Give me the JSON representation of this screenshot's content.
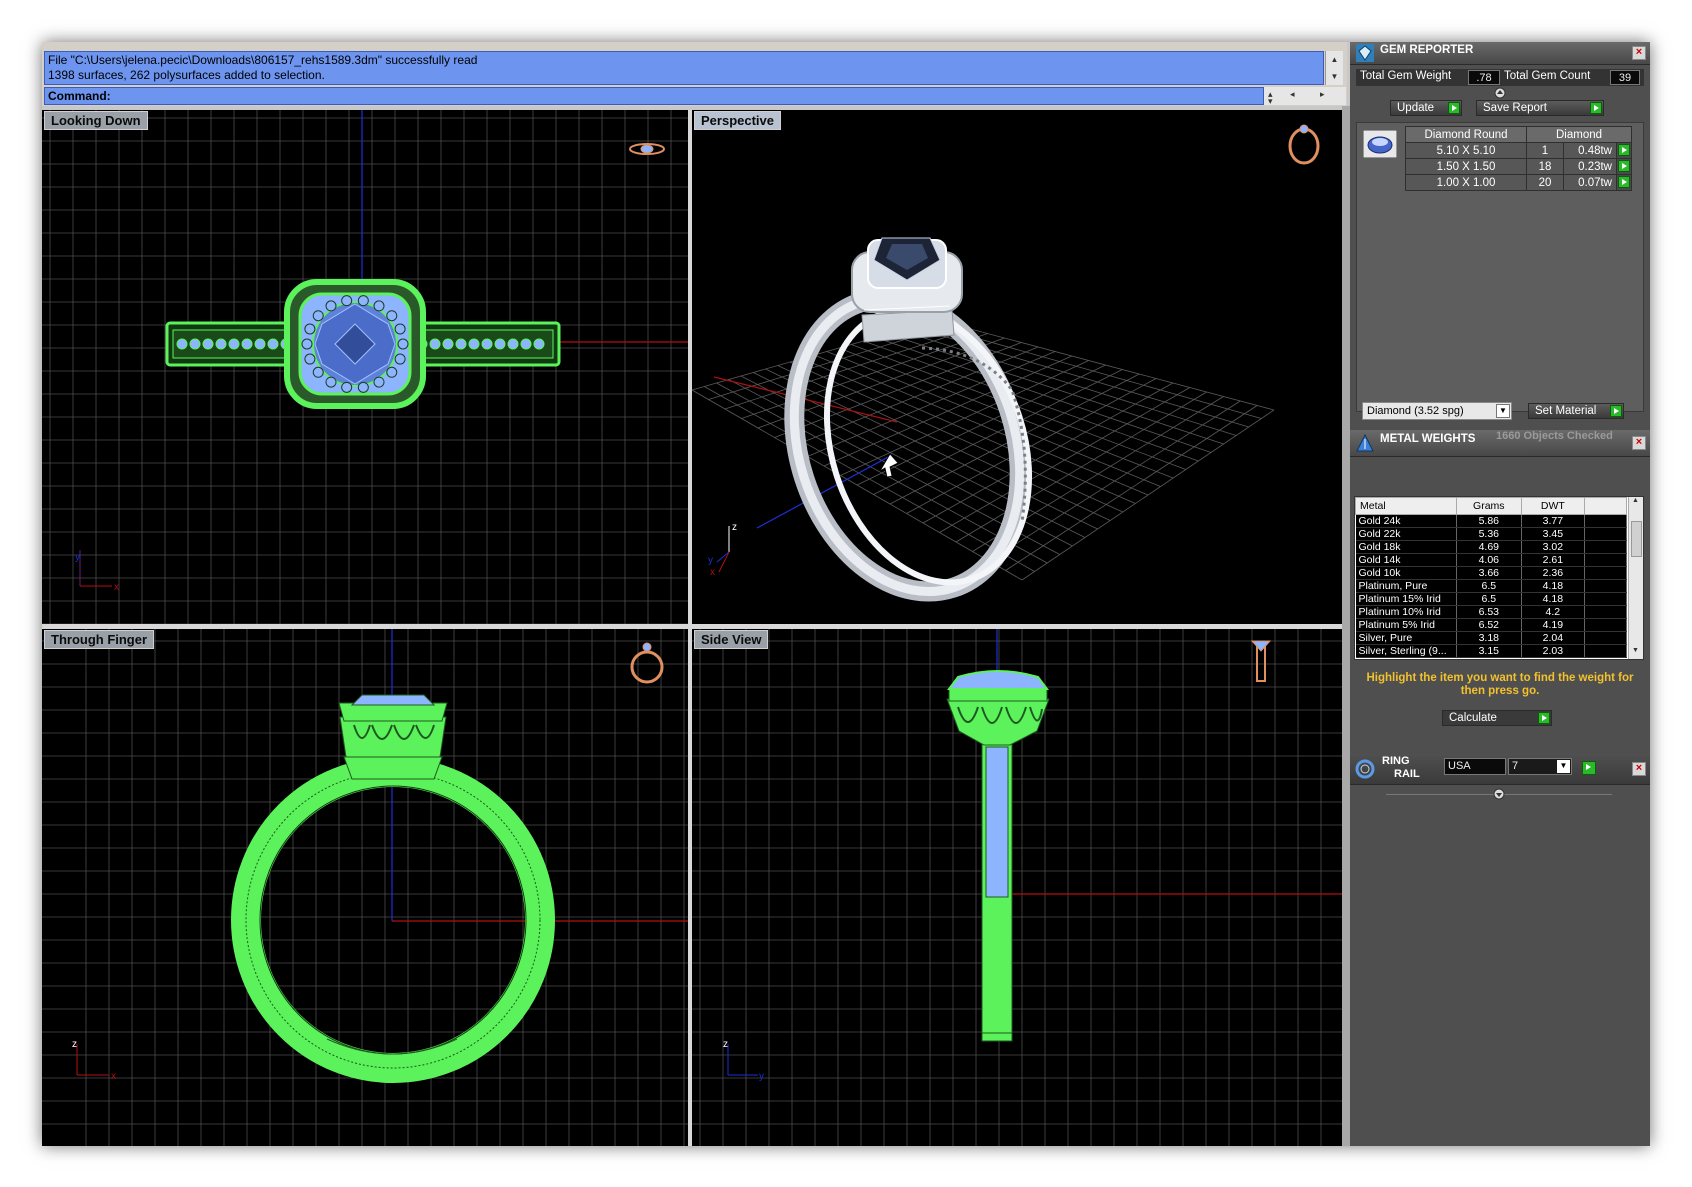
{
  "command_area": {
    "history_lines": [
      "File \"C:\\Users\\jelena.pecic\\Downloads\\806157_rehs1589.3dm\" successfully read",
      "1398 surfaces, 262 polysurfaces added to selection."
    ],
    "command_label": "Command:",
    "command_value": ""
  },
  "viewports": {
    "top_left": "Looking Down",
    "top_right": "Perspective",
    "bottom_left": "Through Finger",
    "bottom_right": "Side View"
  },
  "axis_labels": {
    "x": "x",
    "y": "y",
    "z": "z"
  },
  "gem_reporter": {
    "title": "GEM REPORTER",
    "total_weight_label": "Total Gem Weight",
    "total_weight_value": ".78",
    "total_count_label": "Total Gem Count",
    "total_count_value": "39",
    "update_label": "Update",
    "save_report_label": "Save Report",
    "material_column": "Diamond",
    "shape_column": "Diamond Round",
    "rows": [
      {
        "size": "5.10 X 5.10",
        "count": "1",
        "weight": "0.48tw"
      },
      {
        "size": "1.50 X 1.50",
        "count": "18",
        "weight": "0.23tw"
      },
      {
        "size": "1.00 X 1.00",
        "count": "20",
        "weight": "0.07tw"
      }
    ],
    "material_select": "Diamond   (3.52 spg)",
    "set_material_label": "Set Material"
  },
  "metal_weights": {
    "title": "METAL WEIGHTS",
    "status": "1660 Objects Checked",
    "columns": [
      "Metal",
      "Grams",
      "DWT"
    ],
    "rows": [
      {
        "metal": "Gold 24k",
        "grams": "5.86",
        "dwt": "3.77"
      },
      {
        "metal": "Gold 22k",
        "grams": "5.36",
        "dwt": "3.45"
      },
      {
        "metal": "Gold 18k",
        "grams": "4.69",
        "dwt": "3.02"
      },
      {
        "metal": "Gold 14k",
        "grams": "4.06",
        "dwt": "2.61"
      },
      {
        "metal": "Gold 10k",
        "grams": "3.66",
        "dwt": "2.36"
      },
      {
        "metal": "Platinum, Pure",
        "grams": "6.5",
        "dwt": "4.18"
      },
      {
        "metal": "Platinum 15% Irid",
        "grams": "6.5",
        "dwt": "4.18"
      },
      {
        "metal": "Platinum 10% Irid",
        "grams": "6.53",
        "dwt": "4.2"
      },
      {
        "metal": "Platinum 5% Irid",
        "grams": "6.52",
        "dwt": "4.19"
      },
      {
        "metal": "Silver, Pure",
        "grams": "3.18",
        "dwt": "2.04"
      },
      {
        "metal": "Silver, Sterling (9...",
        "grams": "3.15",
        "dwt": "2.03"
      }
    ],
    "hint": "Highlight the item you want to find the weight for then press go.",
    "calculate_label": "Calculate"
  },
  "ring_rail": {
    "title_line1": "RING",
    "title_line2": "RAIL",
    "country": "USA",
    "size": "7"
  },
  "colors": {
    "history_bg": "#6d95ef",
    "wireframe": "#5cf25c",
    "gem_blue": "#8db4ff",
    "viewport_bg": "#000000",
    "panel_bg": "#4f4f4f",
    "hint_text": "#f2c12e",
    "x_axis": "#b01010",
    "y_axis": "#1a30d8"
  }
}
